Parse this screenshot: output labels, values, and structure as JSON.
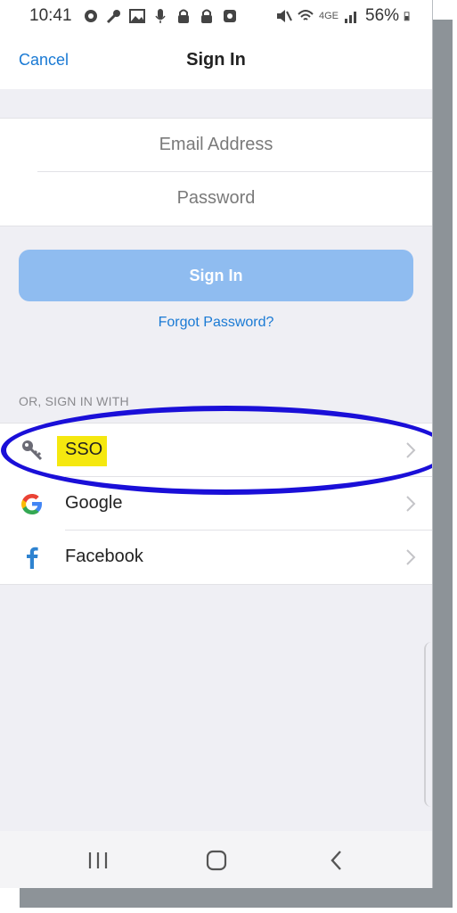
{
  "status_bar": {
    "time": "10:41",
    "battery": "56%",
    "network": "4GE",
    "icons_left": [
      "settings-icon",
      "wrench-icon",
      "image-icon",
      "mic-icon",
      "lock-icon",
      "lock-icon",
      "app-icon"
    ],
    "icons_right": [
      "mute-icon",
      "wifi-icon",
      "signal-icon",
      "battery-icon"
    ]
  },
  "nav": {
    "cancel_label": "Cancel",
    "title": "Sign In"
  },
  "form": {
    "email_placeholder": "Email Address",
    "password_placeholder": "Password"
  },
  "actions": {
    "signin_label": "Sign In",
    "forgot_label": "Forgot Password?"
  },
  "providers_header": "OR, SIGN IN WITH",
  "providers": [
    {
      "label": "SSO",
      "icon": "key-icon"
    },
    {
      "label": "Google",
      "icon": "google-icon"
    },
    {
      "label": "Facebook",
      "icon": "facebook-icon"
    }
  ],
  "colors": {
    "accent": "#1a7ad4",
    "button": "#8fbcf0",
    "highlight": "#f5e80f",
    "annotation": "#1a0fd8"
  }
}
